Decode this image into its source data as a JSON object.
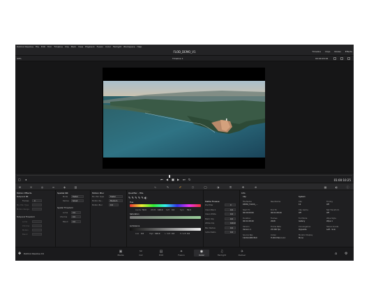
{
  "menu": [
    "DaVinci Resolve",
    "File",
    "Edit",
    "Trim",
    "Timeline",
    "Clip",
    "Mark",
    "View",
    "Playback",
    "Fusion",
    "Color",
    "Fairlight",
    "Workspace",
    "Help"
  ],
  "window": {
    "title": "FLOD_DEMO_V1"
  },
  "top_right": {
    "timeline": "Timeline",
    "clips": "Clips",
    "nodes": "Nodes",
    "effects": "Effects"
  },
  "toolbar2": {
    "zoom": "44%",
    "timeline_name": "Timeline 1",
    "timecode": "00:00:29:16"
  },
  "transport": {
    "timecode": "01:00:10:25"
  },
  "panels": {
    "motion_effects": {
      "title": "Motion Effects",
      "temporal_nr": "Temporal NR",
      "frames_label": "Frames",
      "frames_value": "0",
      "mo_est_type": "Mo. Est. Type",
      "motion_range": "Motion Range",
      "temporal_threshold": "Temporal Threshold",
      "luma_label": "Luma",
      "chroma_label": "Chroma",
      "motion_label": "Motion",
      "blend_label": "Blend"
    },
    "spatial_nr": {
      "title": "Spatial NR",
      "mode_label": "Mode",
      "mode_value": "Faster",
      "radius_label": "Radius",
      "radius_value": "Small",
      "spatial_threshold": "Spatial Threshold",
      "luma_label": "Luma",
      "luma_value": "0.0",
      "chroma_label": "Chroma",
      "chroma_value": "0.0",
      "blend_label": "Blend",
      "blend_value": "0.0"
    },
    "motion_blur": {
      "title": "Motion Blur",
      "mo_est_label": "Mo. Est. Type",
      "mo_est_value": "Faster",
      "motion_range_label": "Motion Ra...",
      "motion_range_value": "Medium",
      "motion_blur_label": "Motion Blur",
      "motion_blur_value": "0.0"
    },
    "qualifier": {
      "title": "Qualifier - HSL",
      "hue": "Hue",
      "saturation": "Saturation",
      "luminance": "Luminance",
      "center_label": "Center",
      "center_value": "50.0",
      "width_label": "Width",
      "width_value": "100.0",
      "soft_label": "Soft",
      "soft_value": "0.0",
      "sym_label": "Sym",
      "sym_value": "50.0",
      "low_label": "Low",
      "low_value": "0.0",
      "high_label": "High",
      "high_value": "100.0",
      "lsoft_label": "L. Soft",
      "lsoft_value": "0.0",
      "hsoft_label": "H. Soft",
      "hsoft_value": "0.0"
    },
    "matte": {
      "title": "Matte Finesse",
      "rows": [
        {
          "k": "Pre-Filter",
          "v": "0"
        },
        {
          "k": "Clean Black",
          "v": "0.0"
        },
        {
          "k": "Clean White",
          "v": "0.0"
        },
        {
          "k": "Black Clip",
          "v": "0.0"
        },
        {
          "k": "White Clip",
          "v": "100.0"
        },
        {
          "k": "Blur Radius",
          "v": "0.0"
        },
        {
          "k": "In/Out Ratio",
          "v": "0.0"
        }
      ]
    },
    "info": {
      "title": "Info",
      "clip_header": "Clip",
      "system_header": "System",
      "clip": [
        {
          "k": "File Name",
          "v": "DEMO_FLOUS_..."
        },
        {
          "k": "Start TC",
          "v": "00:00:00:00"
        },
        {
          "k": "Duration",
          "v": "00:01:08:20"
        },
        {
          "k": "Version",
          "v": "Version 1"
        },
        {
          "k": "Source Res",
          "v": "1920x1080 8bit"
        }
      ],
      "clip2": [
        {
          "k": "Reel Name",
          "v": ""
        },
        {
          "k": "End TC",
          "v": "00:01:08:20"
        },
        {
          "k": "Frames",
          "v": "2048"
        },
        {
          "k": "Frame Rate",
          "v": "25.000 fps"
        },
        {
          "k": "Codec",
          "v": "H.264 Main L4.1"
        }
      ],
      "system": [
        {
          "k": "Clip",
          "v": "16"
        },
        {
          "k": "Clip Cache",
          "v": "Off"
        },
        {
          "k": "Full Mode",
          "v": "Gallery"
        },
        {
          "k": "Convergence",
          "v": "Opposite"
        },
        {
          "k": "Monitor Display",
          "v": "Mono"
        }
      ],
      "system2": [
        {
          "k": "Timing",
          "v": "Off"
        },
        {
          "k": "Net Transform",
          "v": "Off"
        },
        {
          "k": "Wipe Style",
          "v": "Wipe 1"
        },
        {
          "k": "Stereo Grade",
          "v": "Left - Solo"
        }
      ]
    }
  },
  "bottom": {
    "app": "DaVinci Resolve 16",
    "tabs": [
      {
        "label": "Media",
        "icon": "▣"
      },
      {
        "label": "Cut",
        "icon": "✂"
      },
      {
        "label": "Edit",
        "icon": "▤"
      },
      {
        "label": "Fusion",
        "icon": "✦"
      },
      {
        "label": "Color",
        "icon": "◉"
      },
      {
        "label": "Fairlight",
        "icon": "♫"
      },
      {
        "label": "Deliver",
        "icon": "✈"
      }
    ]
  },
  "colors": {
    "accent": "#e0a03a",
    "bg": "#1c1c1e"
  }
}
